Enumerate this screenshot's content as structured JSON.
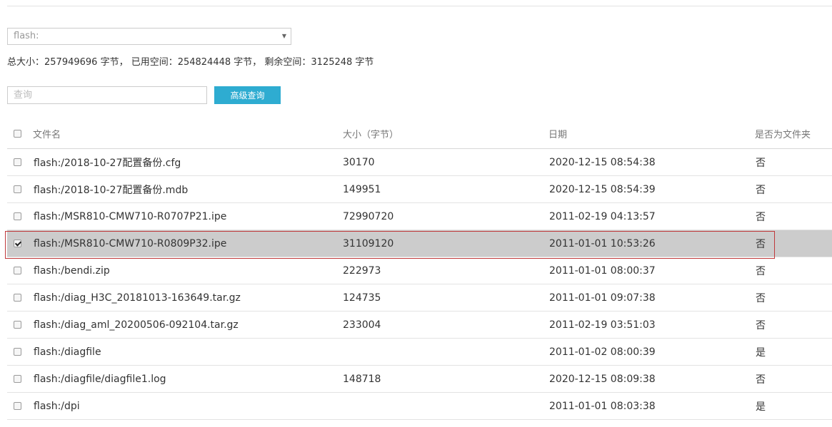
{
  "storage_select": {
    "value": "flash:",
    "arrow_icon": "triangle-down-icon"
  },
  "summary": {
    "text": "总大小：257949696 字节， 已用空间：254824448 字节， 剩余空间：3125248 字节"
  },
  "search": {
    "placeholder": "查询",
    "value": "",
    "advanced_label": "高级查询"
  },
  "table": {
    "headers": {
      "name": "文件名",
      "size": "大小（字节）",
      "date": "日期",
      "is_folder": "是否为文件夹"
    },
    "rows": [
      {
        "name": "flash:/2018-10-27配置备份.cfg",
        "size": "30170",
        "date": "2020-12-15 08:54:38",
        "is_folder": "否",
        "checked": false
      },
      {
        "name": "flash:/2018-10-27配置备份.mdb",
        "size": "149951",
        "date": "2020-12-15 08:54:39",
        "is_folder": "否",
        "checked": false
      },
      {
        "name": "flash:/MSR810-CMW710-R0707P21.ipe",
        "size": "72990720",
        "date": "2011-02-19 04:13:57",
        "is_folder": "否",
        "checked": false
      },
      {
        "name": "flash:/MSR810-CMW710-R0809P32.ipe",
        "size": "31109120",
        "date": "2011-01-01 10:53:26",
        "is_folder": "否",
        "checked": true
      },
      {
        "name": "flash:/bendi.zip",
        "size": "222973",
        "date": "2011-01-01 08:00:37",
        "is_folder": "否",
        "checked": false
      },
      {
        "name": "flash:/diag_H3C_20181013-163649.tar.gz",
        "size": "124735",
        "date": "2011-01-01 09:07:38",
        "is_folder": "否",
        "checked": false
      },
      {
        "name": "flash:/diag_aml_20200506-092104.tar.gz",
        "size": "233004",
        "date": "2011-02-19 03:51:03",
        "is_folder": "否",
        "checked": false
      },
      {
        "name": "flash:/diagfile",
        "size": "",
        "date": "2011-01-02 08:00:39",
        "is_folder": "是",
        "checked": false
      },
      {
        "name": "flash:/diagfile/diagfile1.log",
        "size": "148718",
        "date": "2020-12-15 08:09:38",
        "is_folder": "否",
        "checked": false
      },
      {
        "name": "flash:/dpi",
        "size": "",
        "date": "2011-01-01 08:03:38",
        "is_folder": "是",
        "checked": false
      }
    ]
  },
  "colors": {
    "accent_button": "#2eacd1",
    "selected_row": "#cccccc",
    "highlight_border": "#c0393b"
  }
}
